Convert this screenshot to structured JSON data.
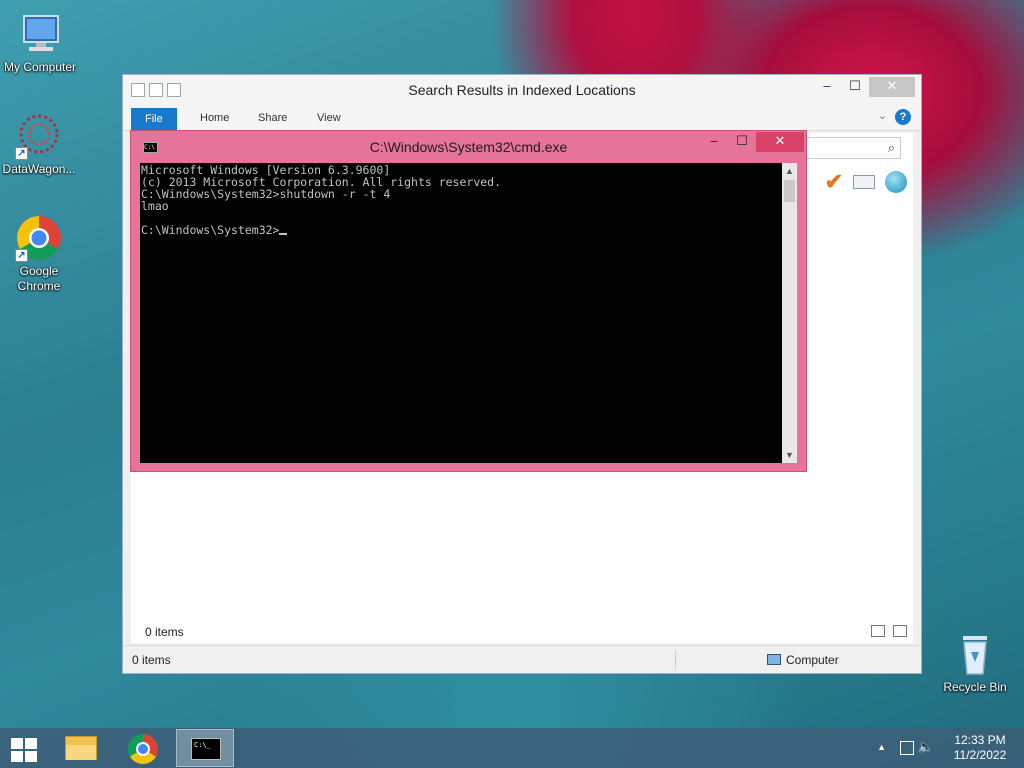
{
  "desktop": {
    "icons": [
      {
        "label": "My Computer"
      },
      {
        "label": "DataWagon..."
      },
      {
        "label": "Google Chrome"
      },
      {
        "label": "Recycle Bin"
      }
    ]
  },
  "explorer": {
    "title": "Search Results in Indexed Locations",
    "tabs": [
      {
        "label": "File"
      },
      {
        "label": "Home"
      },
      {
        "label": "Share"
      },
      {
        "label": "View"
      }
    ],
    "items_count": "0 items",
    "status_left": "0 items",
    "status_right": "Computer"
  },
  "cmd": {
    "title": "C:\\Windows\\System32\\cmd.exe",
    "console_text": "Microsoft Windows [Version 6.3.9600]\n(c) 2013 Microsoft Corporation. All rights reserved.\nC:\\Windows\\System32>shutdown -r -t 4\nlmao\n\nC:\\Windows\\System32>"
  },
  "taskbar": {
    "time": "12:33 PM",
    "date": "11/2/2022"
  }
}
